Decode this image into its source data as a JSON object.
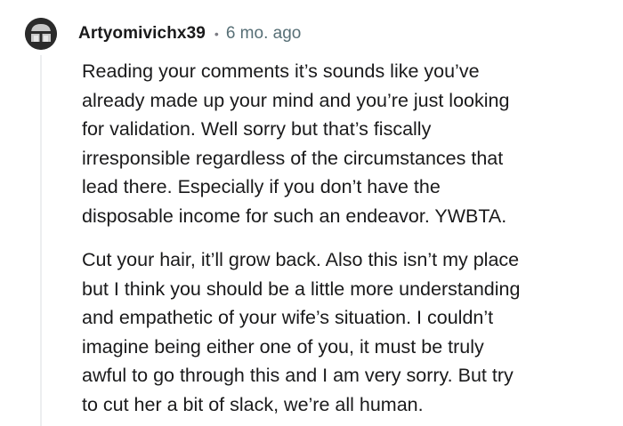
{
  "comment": {
    "author": "Artyomivichx39",
    "separator": "•",
    "timestamp": "6 mo. ago",
    "avatar_icon": "helmet-avatar-icon",
    "paragraphs": [
      "Reading your comments it’s sounds like you’ve\nalready made up your mind and you’re just looking\nfor validation. Well sorry but that’s fiscally\nirresponsible regardless of the circumstances that\nlead there. Especially if you don’t have the\ndisposable income for such an endeavor. YWBTA.",
      "Cut your hair, it’ll grow back. Also this isn’t my place\nbut I think you should be a little more understanding\nand empathetic of your wife’s situation. I couldn’t\nimagine being either one of you, it must be truly\nawful to go through this and I am very sorry. But try\nto cut her a bit of slack, we’re all human."
    ]
  },
  "colors": {
    "text": "#1a1a1b",
    "meta": "#576f76",
    "thread_line": "#eceef0",
    "avatar_bg": "#2b2b2b"
  }
}
